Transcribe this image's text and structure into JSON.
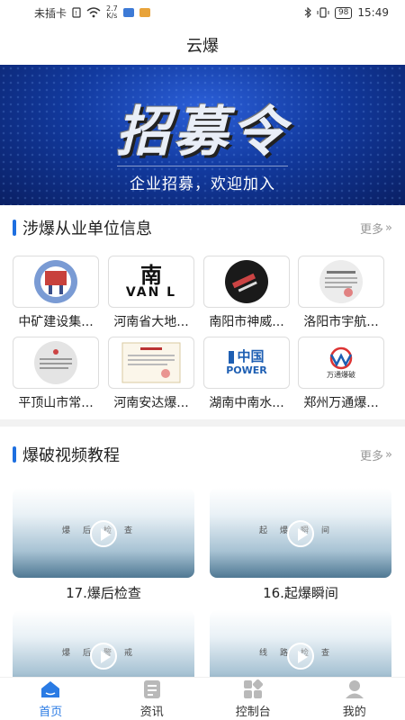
{
  "status_bar": {
    "carrier": "未插卡",
    "speed_value": "2.7",
    "speed_unit": "K/s",
    "battery": "98",
    "time": "15:49"
  },
  "app_title": "云爆",
  "banner": {
    "headline": "招募令",
    "subtitle": "企业招募，欢迎加入"
  },
  "units_section": {
    "title": "涉爆从业单位信息",
    "more_label": "更多",
    "items": [
      {
        "label": "中矿建设集..."
      },
      {
        "label": "河南省大地..."
      },
      {
        "label": "南阳市神威..."
      },
      {
        "label": "洛阳市宇航..."
      },
      {
        "label": "平顶山市常..."
      },
      {
        "label": "河南安达爆..."
      },
      {
        "label": "湖南中南水..."
      },
      {
        "label": "郑州万通爆..."
      }
    ],
    "thumb_texts": {
      "nan": "南",
      "vanl": "VAN L",
      "zhongguo": "中国",
      "power": "POWER",
      "wantong": "万通爆破"
    }
  },
  "video_section": {
    "title": "爆破视频教程",
    "more_label": "更多",
    "videos": [
      {
        "label": "17.爆后检查",
        "thumb_text": "爆后检查"
      },
      {
        "label": "16.起爆瞬间",
        "thumb_text": "起爆瞬间"
      },
      {
        "label": "",
        "thumb_text": "爆后警戒"
      },
      {
        "label": "",
        "thumb_text": "线路检查"
      }
    ]
  },
  "tabbar": {
    "tabs": [
      {
        "label": "首页",
        "icon": "home-icon",
        "active": true
      },
      {
        "label": "资讯",
        "icon": "news-icon",
        "active": false
      },
      {
        "label": "控制台",
        "icon": "console-icon",
        "active": false
      },
      {
        "label": "我的",
        "icon": "profile-icon",
        "active": false
      }
    ]
  },
  "colors": {
    "accent": "#2a7be4",
    "section_bar": "#1e6fe0",
    "banner_blue": "#123a9f"
  }
}
